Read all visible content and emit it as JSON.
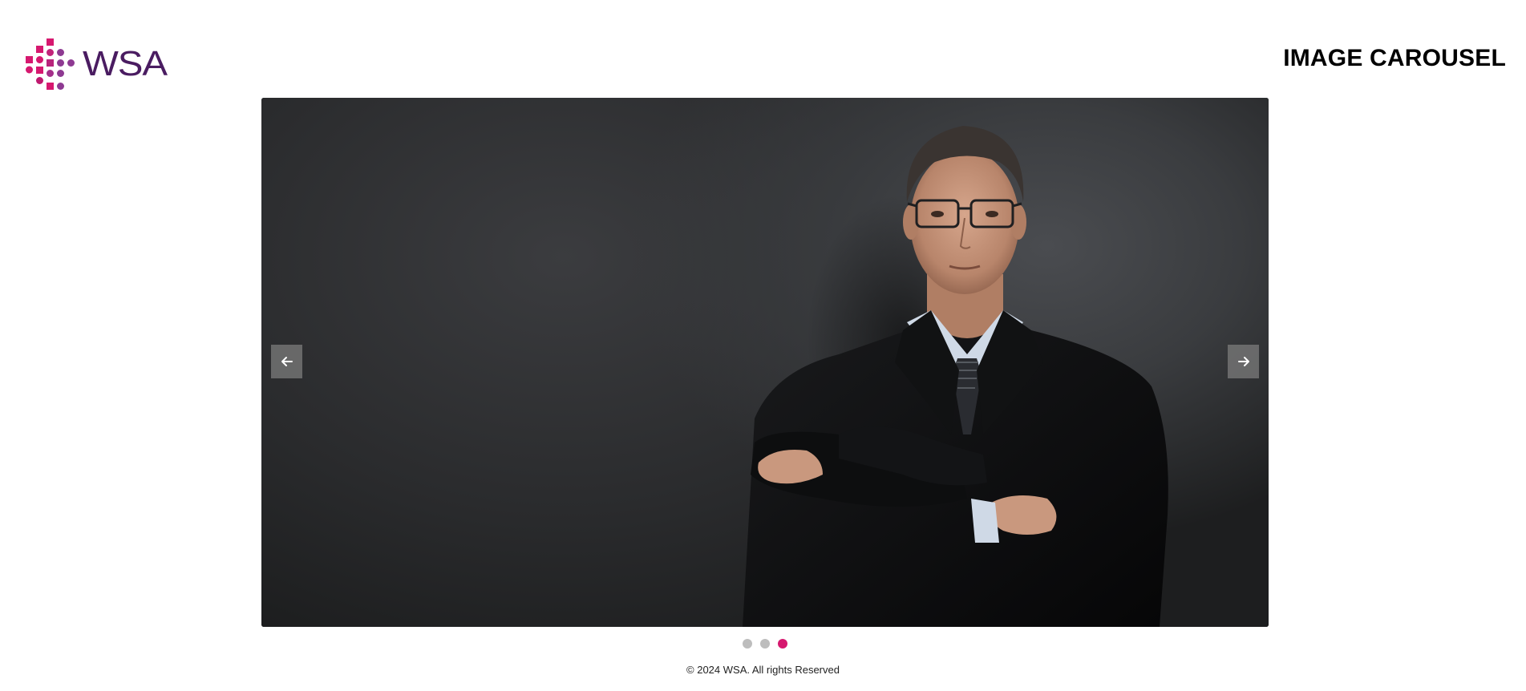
{
  "brand": {
    "name": "WSA",
    "primary_color": "#d6186f",
    "secondary_color": "#4a1c61"
  },
  "header": {
    "title": "IMAGE CAROUSEL"
  },
  "carousel": {
    "prev_icon": "arrow-left-icon",
    "next_icon": "arrow-right-icon",
    "slide_count": 3,
    "active_index": 2,
    "active_color": "#d6186f",
    "inactive_color": "#bdbdbd"
  },
  "footer": {
    "text": "© 2024 WSA. All rights Reserved"
  }
}
